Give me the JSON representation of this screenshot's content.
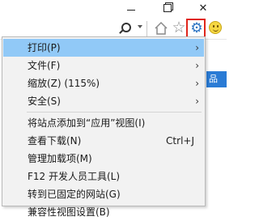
{
  "window": {
    "minimize_glyph": "—",
    "maximize_glyph": "❐",
    "close_glyph": "✕"
  },
  "toolbar": {
    "icons": [
      "search-icon",
      "chevron-down-icon",
      "home-icon",
      "favorites-star-icon",
      "gear-icon",
      "smiley-feedback-icon"
    ],
    "star_glyph": "☆",
    "gear_glyph": "⚙",
    "highlight_color": "#e0261b",
    "gear_color": "#2a72c2"
  },
  "page": {
    "tab_text": "品"
  },
  "menu": {
    "highlight_color": "#91c9f7",
    "items": [
      {
        "label": "打印(P)",
        "shortcut": "",
        "submenu": true
      },
      {
        "label": "文件(F)",
        "shortcut": "",
        "submenu": true
      },
      {
        "label": "缩放(Z) (115%)",
        "shortcut": "",
        "submenu": true
      },
      {
        "label": "安全(S)",
        "shortcut": "",
        "submenu": true
      },
      {
        "label": "将站点添加到“应用”视图(I)",
        "shortcut": "",
        "submenu": false
      },
      {
        "label": "查看下载(N)",
        "shortcut": "Ctrl+J",
        "submenu": false
      },
      {
        "label": "管理加载项(M)",
        "shortcut": "",
        "submenu": false
      },
      {
        "label": "F12 开发人员工具(L)",
        "shortcut": "",
        "submenu": false
      },
      {
        "label": "转到已固定的网站(G)",
        "shortcut": "",
        "submenu": false
      },
      {
        "label": "兼容性视图设置(B)",
        "shortcut": "",
        "submenu": false
      }
    ],
    "arrow_glyph": "›"
  }
}
